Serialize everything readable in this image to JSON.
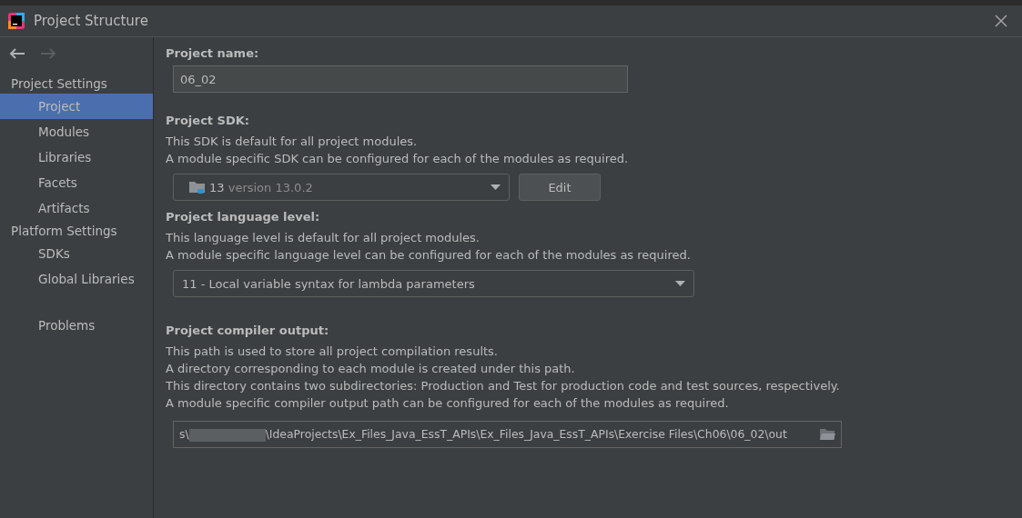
{
  "window": {
    "title": "Project Structure"
  },
  "sidebar": {
    "groups": [
      {
        "heading": "Project Settings",
        "items": [
          {
            "label": "Project",
            "selected": true
          },
          {
            "label": "Modules",
            "selected": false
          },
          {
            "label": "Libraries",
            "selected": false
          },
          {
            "label": "Facets",
            "selected": false
          },
          {
            "label": "Artifacts",
            "selected": false
          }
        ]
      },
      {
        "heading": "Platform Settings",
        "items": [
          {
            "label": "SDKs",
            "selected": false
          },
          {
            "label": "Global Libraries",
            "selected": false
          }
        ]
      }
    ],
    "bottom_items": [
      {
        "label": "Problems",
        "selected": false
      }
    ]
  },
  "project_name": {
    "label": "Project name:",
    "value": "06_02"
  },
  "project_sdk": {
    "label": "Project SDK:",
    "description": [
      "This SDK is default for all project modules.",
      "A module specific SDK can be configured for each of the modules as required."
    ],
    "name": "13",
    "version": "version 13.0.2",
    "edit_button": "Edit"
  },
  "language_level": {
    "label": "Project language level:",
    "description": [
      "This language level is default for all project modules.",
      "A module specific language level can be configured for each of the modules as required."
    ],
    "value": "11 - Local variable syntax for lambda parameters"
  },
  "compiler_output": {
    "label": "Project compiler output:",
    "description": [
      "This path is used to store all project compilation results.",
      "A directory corresponding to each module is created under this path.",
      "This directory contains two subdirectories: Production and Test for production code and test sources, respectively.",
      "A module specific compiler output path can be configured for each of the modules as required."
    ],
    "path_start": "s\\",
    "path_rest": "\\IdeaProjects\\Ex_Files_Java_EssT_APIs\\Ex_Files_Java_EssT_APIs\\Exercise Files\\Ch06\\06_02\\out"
  }
}
